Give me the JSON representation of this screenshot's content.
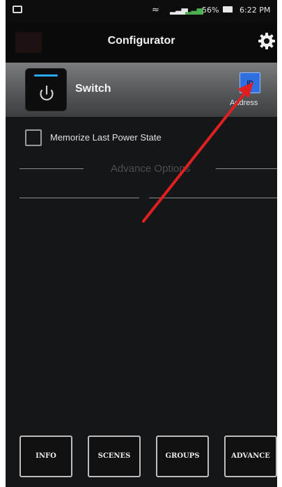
{
  "status_bar": {
    "battery": "56%",
    "time": "6:22 PM"
  },
  "app_bar": {
    "title": "Configurator",
    "settings_icon": "gear-icon"
  },
  "device": {
    "name": "Switch",
    "icon": "power-icon",
    "address_button": "ID",
    "address_label": "Address"
  },
  "options": {
    "memorize_label": "Memorize Last Power State",
    "memorize_checked": false,
    "advance_title": "Advance Options"
  },
  "bottom_nav": {
    "info": "INFO",
    "scenes": "SCENES",
    "groups": "GROUPS",
    "advance": "ADVANCE"
  },
  "colors": {
    "background": "#151617",
    "accent": "#2f6fe0",
    "annotation": "#e02020"
  }
}
